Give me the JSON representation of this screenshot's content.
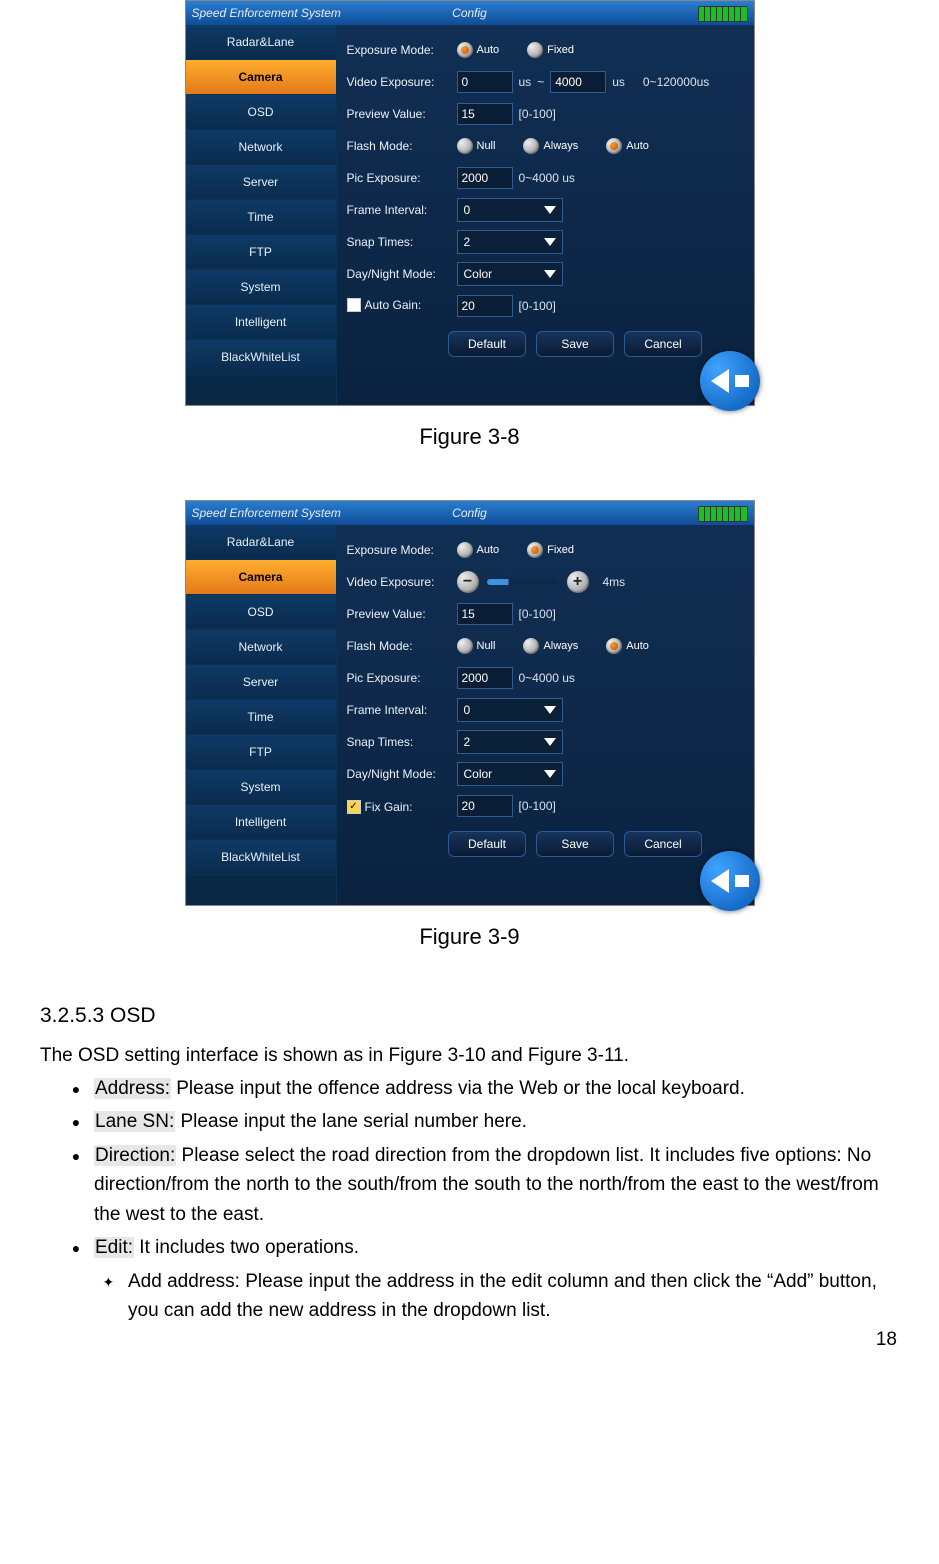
{
  "pageNumber": "18",
  "figures": {
    "f1": {
      "caption": "Figure 3-8",
      "titleLeft": "Speed Enforcement System",
      "titleCenter": "Config",
      "sidebar": [
        "Radar&Lane",
        "Camera",
        "OSD",
        "Network",
        "Server",
        "Time",
        "FTP",
        "System",
        "Intelligent",
        "BlackWhiteList"
      ],
      "selected": "Camera",
      "rows": {
        "exposureMode": {
          "label": "Exposure Mode:",
          "opt1": "Auto",
          "opt2": "Fixed"
        },
        "videoExposure": {
          "label": "Video Exposure:",
          "v1": "0",
          "u1": "us",
          "sep": "~",
          "v2": "4000",
          "u2": "us",
          "range": "0~120000us"
        },
        "previewValue": {
          "label": "Preview Value:",
          "v": "15",
          "range": "[0-100]"
        },
        "flashMode": {
          "label": "Flash Mode:",
          "o1": "Null",
          "o2": "Always",
          "o3": "Auto"
        },
        "picExposure": {
          "label": "Pic Exposure:",
          "v": "2000",
          "range": "0~4000 us"
        },
        "frameInterval": {
          "label": "Frame Interval:",
          "v": "0"
        },
        "snapTimes": {
          "label": "Snap Times:",
          "v": "2"
        },
        "dayNight": {
          "label": "Day/Night Mode:",
          "v": "Color"
        },
        "gain": {
          "label": "Auto Gain:",
          "v": "20",
          "range": "[0-100]"
        }
      },
      "buttons": {
        "default": "Default",
        "save": "Save",
        "cancel": "Cancel"
      }
    },
    "f2": {
      "caption": "Figure 3-9",
      "titleLeft": "Speed Enforcement System",
      "titleCenter": "Config",
      "sidebar": [
        "Radar&Lane",
        "Camera",
        "OSD",
        "Network",
        "Server",
        "Time",
        "FTP",
        "System",
        "Intelligent",
        "BlackWhiteList"
      ],
      "selected": "Camera",
      "rows": {
        "exposureMode": {
          "label": "Exposure Mode:",
          "opt1": "Auto",
          "opt2": "Fixed"
        },
        "videoExposure": {
          "label": "Video Exposure:",
          "value": "4ms"
        },
        "previewValue": {
          "label": "Preview Value:",
          "v": "15",
          "range": "[0-100]"
        },
        "flashMode": {
          "label": "Flash Mode:",
          "o1": "Null",
          "o2": "Always",
          "o3": "Auto"
        },
        "picExposure": {
          "label": "Pic Exposure:",
          "v": "2000",
          "range": "0~4000 us"
        },
        "frameInterval": {
          "label": "Frame Interval:",
          "v": "0"
        },
        "snapTimes": {
          "label": "Snap Times:",
          "v": "2"
        },
        "dayNight": {
          "label": "Day/Night Mode:",
          "v": "Color"
        },
        "gain": {
          "label": "Fix Gain:",
          "v": "20",
          "range": "[0-100]"
        }
      },
      "buttons": {
        "default": "Default",
        "save": "Save",
        "cancel": "Cancel"
      }
    }
  },
  "doc": {
    "heading": "3.2.5.3  OSD",
    "intro": "The OSD setting interface is shown as in Figure 3-10 and Figure 3-11.",
    "b1": {
      "k": "Address:",
      "t": " Please input the offence address via the Web or the local keyboard."
    },
    "b2": {
      "k": "Lane SN:",
      "t": " Please input the lane serial number here."
    },
    "b3": {
      "k": "Direction:",
      "t": " Please select the road direction from the dropdown list.  It includes five options: No direction/from the north to the south/from the south to the north/from the east to the west/from the west to the east."
    },
    "b4": {
      "k": "Edit:",
      "t": " It includes two operations."
    },
    "b4a": "Add address: Please input the address in the edit column and then click the “Add” button, you can add the new address in the dropdown list."
  }
}
